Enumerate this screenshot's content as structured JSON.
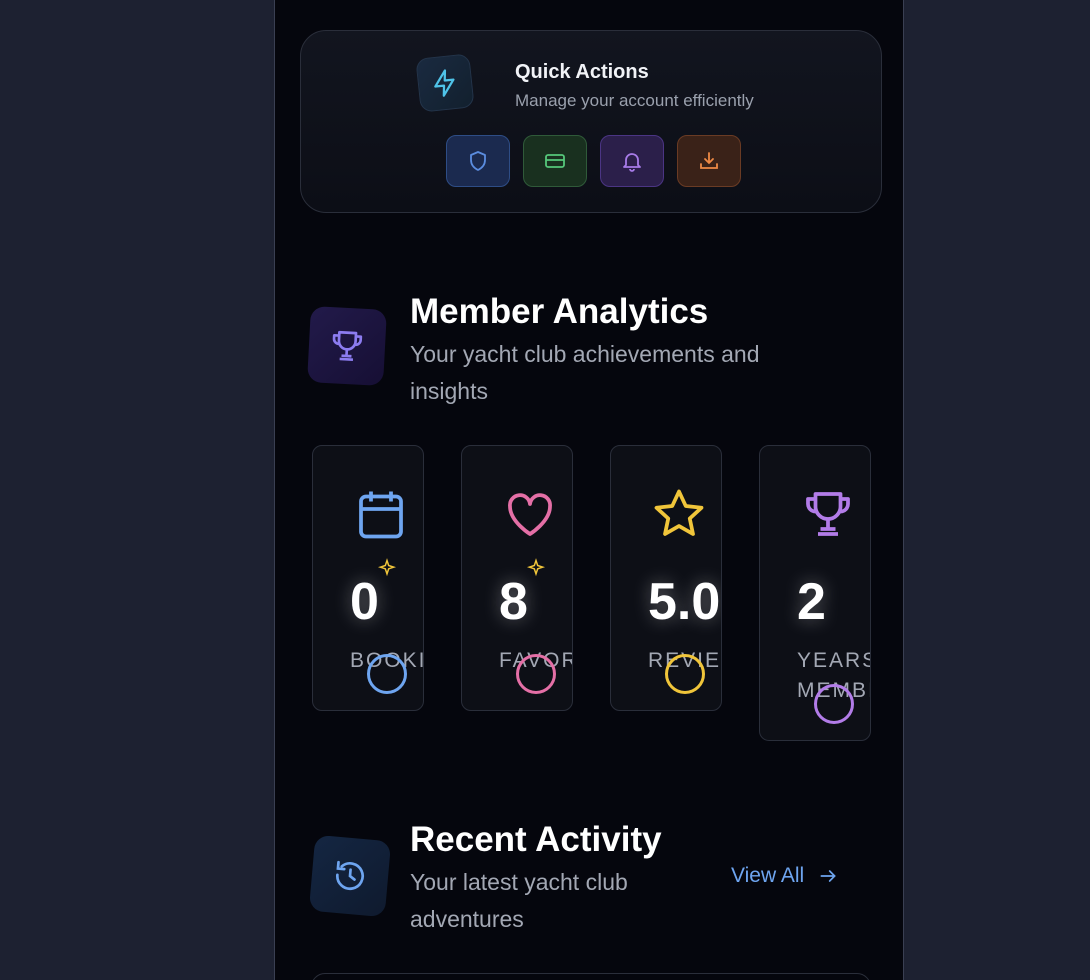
{
  "quick_actions": {
    "title": "Quick Actions",
    "subtitle": "Manage your account efficiently",
    "buttons": [
      {
        "icon": "shield-icon",
        "color": "#5b8de0"
      },
      {
        "icon": "credit-card-icon",
        "color": "#55c77a"
      },
      {
        "icon": "bell-icon",
        "color": "#a77be8"
      },
      {
        "icon": "download-icon",
        "color": "#ef8a45"
      }
    ]
  },
  "member_analytics": {
    "title": "Member Analytics",
    "subtitle": "Your yacht club achievements and insights",
    "stats": [
      {
        "value": "0",
        "label": "BOOKI",
        "icon": "calendar-icon",
        "color": "#6ea5f0"
      },
      {
        "value": "8",
        "label": "FAVOR",
        "icon": "heart-icon",
        "color": "#e46fa6"
      },
      {
        "value": "5.0",
        "label": "REVIEV",
        "icon": "star-icon",
        "color": "#f0c53a"
      },
      {
        "value": "2",
        "label": "YEARS MEMBI",
        "icon": "trophy-icon",
        "color": "#b27ce8"
      }
    ]
  },
  "recent_activity": {
    "title": "Recent Activity",
    "subtitle": "Your latest yacht club adventures",
    "view_all_label": "View All"
  }
}
